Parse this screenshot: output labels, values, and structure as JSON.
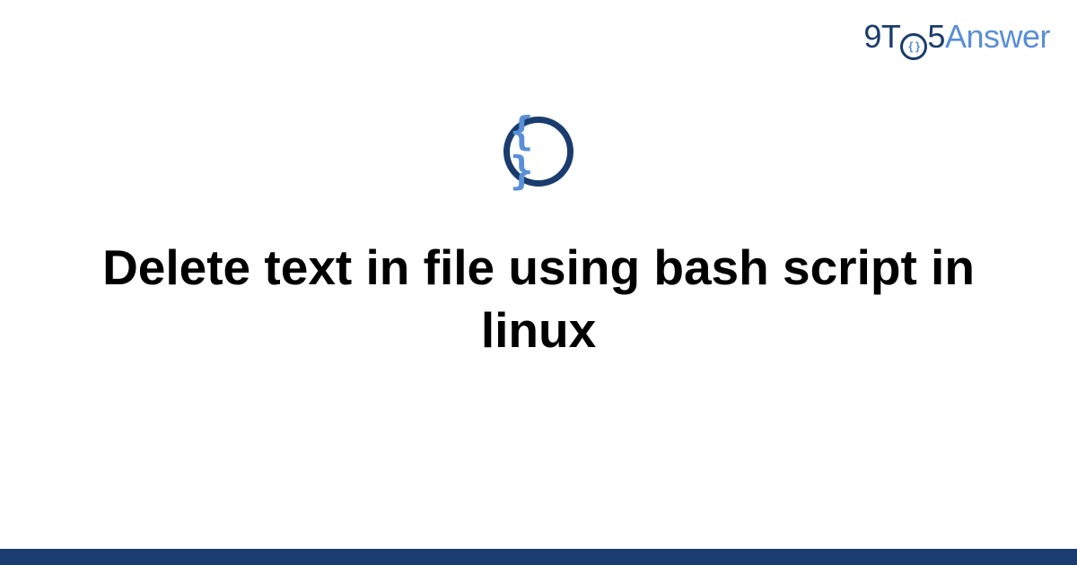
{
  "header": {
    "logo": {
      "prefix_nine": "9",
      "prefix_t": "T",
      "o_inner_braces": "{ }",
      "prefix_five": "5",
      "suffix": "Answer"
    }
  },
  "content": {
    "icon_braces": "{ }",
    "title": "Delete text in file using bash script in linux"
  },
  "colors": {
    "primary": "#1a3c6e",
    "accent": "#5a8fd6"
  }
}
